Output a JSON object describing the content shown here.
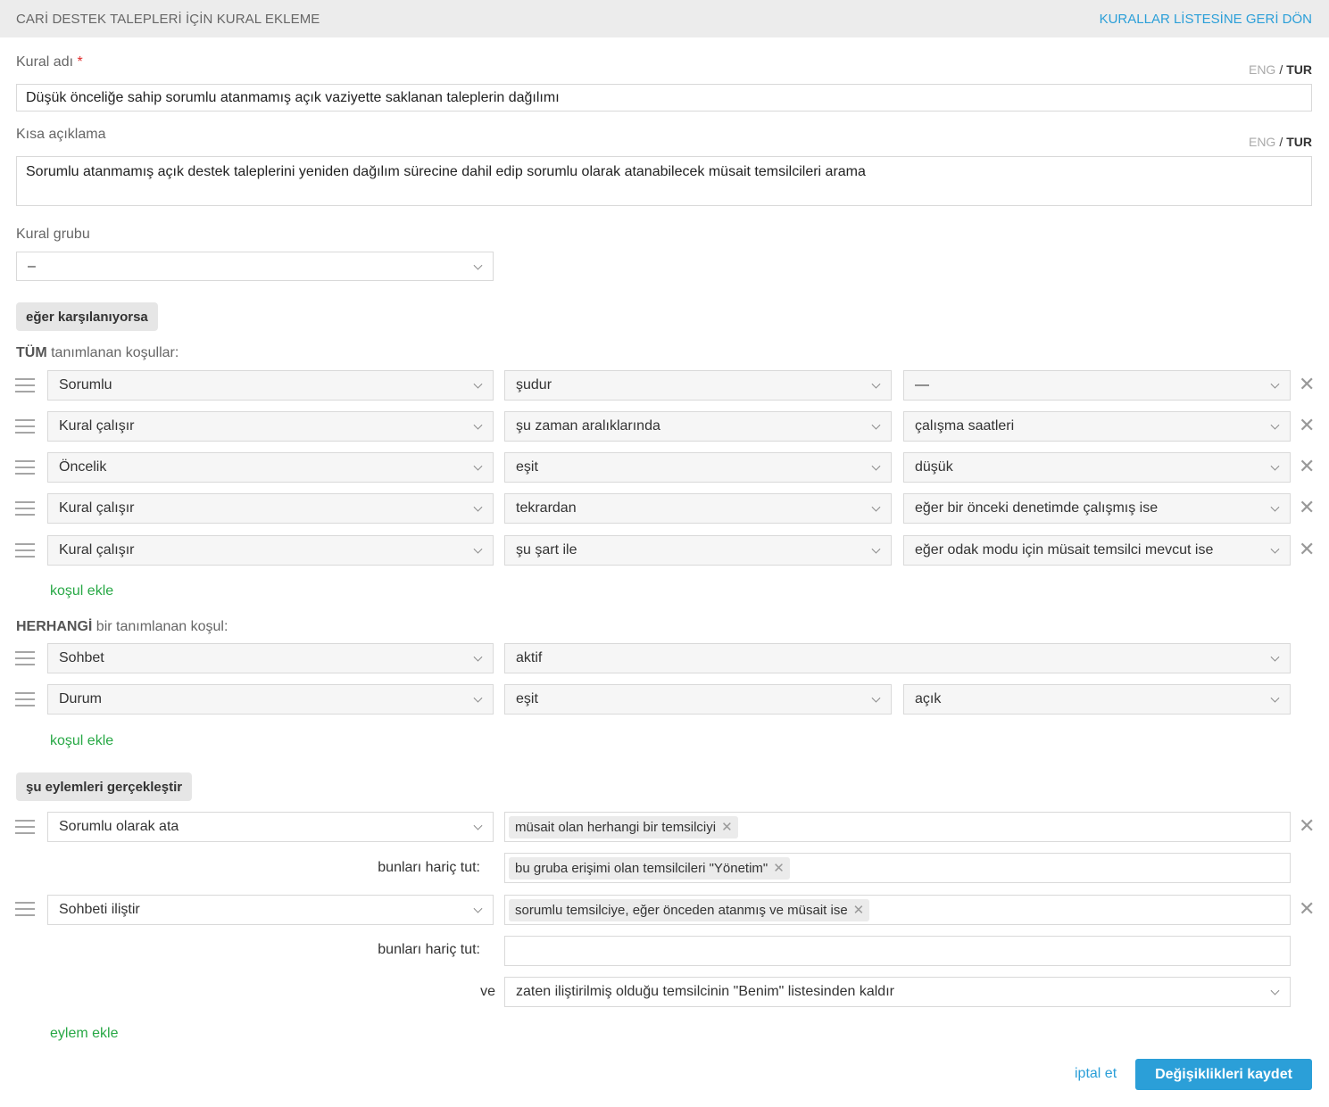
{
  "header": {
    "title": "CARİ DESTEK TALEPLERİ İÇİN KURAL EKLEME",
    "back_link": "KURALLAR LİSTESİNE GERİ DÖN"
  },
  "lang_switch": {
    "eng": "ENG",
    "sep": "/",
    "tur": "TUR"
  },
  "rule_name": {
    "label": "Kural adı",
    "required_mark": "*",
    "value": "Düşük önceliğe sahip sorumlu atanmamış açık vaziyette saklanan taleplerin dağılımı"
  },
  "short_description": {
    "label": "Kısa açıklama",
    "value": "Sorumlu atanmamış açık destek taleplerini yeniden dağılım sürecine dahil edip sorumlu olarak atanabilecek müsait temsilcileri arama"
  },
  "rule_group": {
    "label": "Kural grubu",
    "value": "–"
  },
  "if_section": {
    "label": "eğer karşılanıyorsa"
  },
  "all_conditions": {
    "title_bold": "TÜM",
    "title_rest": "tanımlanan koşullar:",
    "rows": [
      {
        "field": "Sorumlu",
        "operator": "şudur",
        "value": "—"
      },
      {
        "field": "Kural çalışır",
        "operator": "şu zaman aralıklarında",
        "value": "çalışma saatleri"
      },
      {
        "field": "Öncelik",
        "operator": "eşit",
        "value": "düşük"
      },
      {
        "field": "Kural çalışır",
        "operator": "tekrardan",
        "value": "eğer bir önceki denetimde çalışmış ise"
      },
      {
        "field": "Kural çalışır",
        "operator": "şu şart ile",
        "value": "eğer odak modu için müsait temsilci mevcut ise"
      }
    ],
    "add_label": "koşul ekle"
  },
  "any_conditions": {
    "title_bold": "HERHANGİ",
    "title_rest": "bir tanımlanan koşul:",
    "rows": [
      {
        "field": "Sohbet",
        "operator": "aktif"
      },
      {
        "field": "Durum",
        "operator": "eşit",
        "value": "açık"
      }
    ],
    "add_label": "koşul ekle"
  },
  "actions_section": {
    "label": "şu eylemleri gerçekleştir"
  },
  "actions": {
    "items": [
      {
        "action": "Sorumlu olarak ata",
        "tag": "müsait olan herhangi bir temsilciyi",
        "exclude_label": "bunları hariç tut:",
        "exclude_tag": "bu gruba erişimi olan temsilcileri \"Yönetim\""
      },
      {
        "action": "Sohbeti iliştir",
        "tag": "sorumlu temsilciye, eğer önceden atanmış ve müsait ise",
        "exclude_label": "bunları hariç tut:",
        "and_label": "ve",
        "and_value": "zaten iliştirilmiş olduğu temsilcinin \"Benim\" listesinden kaldır"
      }
    ],
    "add_label": "eylem ekle"
  },
  "footer": {
    "cancel": "iptal et",
    "save": "Değişiklikleri kaydet"
  },
  "icons": {
    "remove": "✕",
    "tag_remove": "✕"
  }
}
